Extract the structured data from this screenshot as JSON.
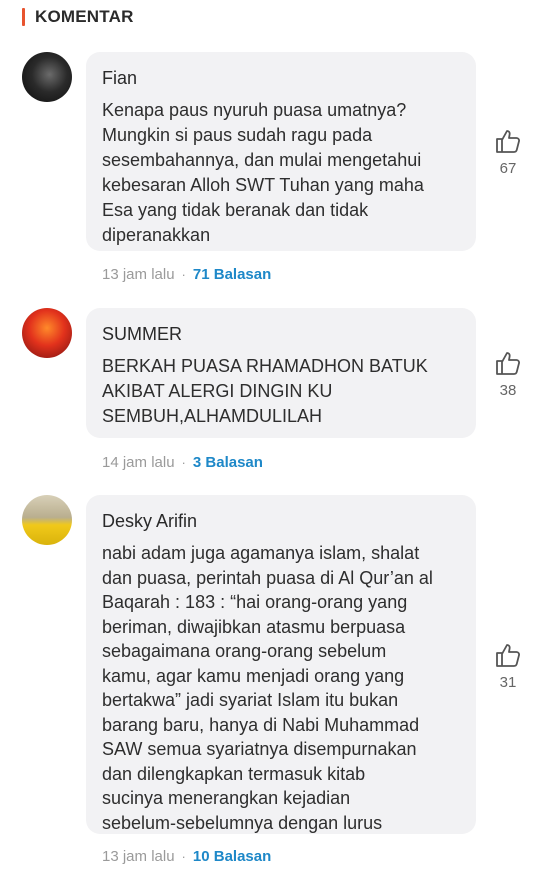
{
  "section": {
    "title": "KOMENTAR",
    "accent_color": "#e8542f"
  },
  "comments": [
    {
      "name": "Fian",
      "text": "Kenapa paus nyuruh puasa umatnya?\nMungkin si paus sudah ragu pada\nsesembahannya, dan mulai mengetahui\nkebesaran Alloh SWT Tuhan yang maha\nEsa yang tidak beranak dan tidak\ndiperanakkan",
      "likes": "67",
      "time": "13 jam lalu",
      "replies": "71 Balasan"
    },
    {
      "name": "SUMMER",
      "text": "BERKAH PUASA RHAMADHON BATUK\nAKIBAT ALERGI DINGIN KU\nSEMBUH,ALHAMDULILAH",
      "likes": "38",
      "time": "14 jam lalu",
      "replies": "3 Balasan"
    },
    {
      "name": "Desky Arifin",
      "text": "nabi adam juga agamanya islam, shalat\ndan puasa, perintah puasa di Al Qur’an al\nBaqarah : 183 : “hai orang-orang yang\nberiman, diwajibkan atasmu berpuasa\nsebagaimana orang-orang sebelum\nkamu, agar kamu menjadi orang yang\nbertakwa” jadi syariat Islam itu bukan\nbarang baru, hanya di Nabi Muhammad\nSAW semua syariatnya disempurnakan\ndan dilengkapkan termasuk kitab\nsucinya menerangkan kejadian\nsebelum-sebelumnya dengan lurus",
      "likes": "31",
      "time": "13 jam lalu",
      "replies": "10 Balasan"
    }
  ],
  "separator": "·",
  "colors": {
    "bubble": "#f2f2f4",
    "reply_link": "#1e88c8",
    "meta": "#9a9a9a"
  },
  "icons": {
    "like": "thumbs-up-icon"
  }
}
